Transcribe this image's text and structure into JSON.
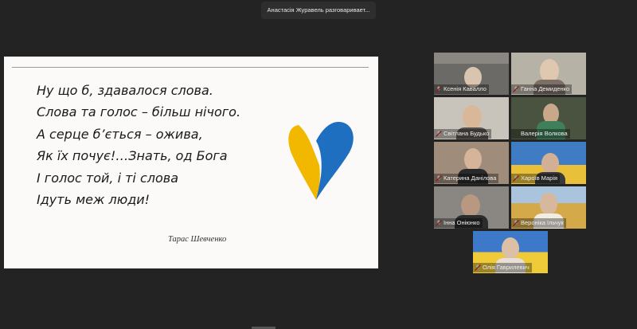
{
  "speaker_notice": "Анастасія Журавель разговаривает...",
  "slide": {
    "poem_lines": [
      "Ну що б, здавалося слова.",
      "Слова та голос – більш нічого.",
      "А серце б’ється – ожива,",
      "Як їх почує!…Знать, од Бога",
      "І голос той, і ті слова",
      "Ідуть меж люди!"
    ],
    "author": "Тарас Шевченко"
  },
  "participants": [
    "Ксенія Кавалло",
    "Ганна Демиденко",
    "Світлана Будько",
    "Валерія Волкова",
    "Катерина Данілова",
    "Хароїв Марія",
    "Інна Оніюнко",
    "Вероніка Ільчук",
    "Олія Гаврилевич"
  ],
  "colors": {
    "heart_blue": "#1f6fc0",
    "heart_yellow": "#f2b800",
    "mic_muted": "#d9322b"
  },
  "icons": {
    "mic": "microphone-muted-icon"
  }
}
